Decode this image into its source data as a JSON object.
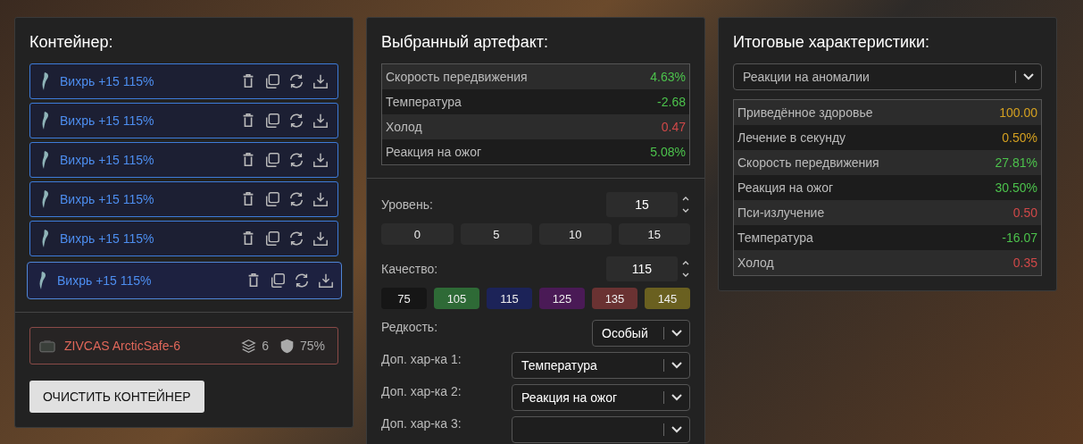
{
  "container": {
    "title": "Контейнер:",
    "artifacts": [
      {
        "name": "Вихрь +15 115%",
        "selected": false
      },
      {
        "name": "Вихрь +15 115%",
        "selected": false
      },
      {
        "name": "Вихрь +15 115%",
        "selected": false
      },
      {
        "name": "Вихрь +15 115%",
        "selected": false
      },
      {
        "name": "Вихрь +15 115%",
        "selected": false
      },
      {
        "name": "Вихрь +15 115%",
        "selected": true
      }
    ],
    "case": {
      "name": "ZIVCAS ArcticSafe-6",
      "slots": "6",
      "protection": "75%"
    },
    "clear_button": "ОЧИСТИТЬ КОНТЕЙНЕР"
  },
  "selected_artifact": {
    "title": "Выбранный артефакт:",
    "stats": [
      {
        "name": "Скорость передвижения",
        "value": "4.63%",
        "color": "#4cc24c"
      },
      {
        "name": "Температура",
        "value": "-2.68",
        "color": "#4cc24c"
      },
      {
        "name": "Холод",
        "value": "0.47",
        "color": "#d04848"
      },
      {
        "name": "Реакция на ожог",
        "value": "5.08%",
        "color": "#4cc24c"
      }
    ],
    "level": {
      "label": "Уровень:",
      "value": "15",
      "presets": [
        "0",
        "5",
        "10",
        "15"
      ]
    },
    "quality": {
      "label": "Качество:",
      "value": "115",
      "presets": [
        {
          "label": "75",
          "color": "#161616"
        },
        {
          "label": "105",
          "color": "#2e6a36"
        },
        {
          "label": "115",
          "color": "#1c2358"
        },
        {
          "label": "125",
          "color": "#4a1a56"
        },
        {
          "label": "135",
          "color": "#6a3232"
        },
        {
          "label": "145",
          "color": "#6a6020"
        }
      ]
    },
    "selects": [
      {
        "label": "Редкость:",
        "value": "Особый",
        "kind": "short"
      },
      {
        "label": "Доп. хар-ка 1:",
        "value": "Температура",
        "kind": "wide"
      },
      {
        "label": "Доп. хар-ка 2:",
        "value": "Реакция на ожог",
        "kind": "wide"
      },
      {
        "label": "Доп. хар-ка 3:",
        "kind": "wide"
      }
    ]
  },
  "totals": {
    "title": "Итоговые характеристики:",
    "filter": "Реакции на аномалии",
    "stats": [
      {
        "name": "Приведённое здоровье",
        "value": "100.00",
        "color": "#d4a020"
      },
      {
        "name": "Лечение в секунду",
        "value": "0.50%",
        "color": "#d4a020"
      },
      {
        "name": "Скорость передвижения",
        "value": "27.81%",
        "color": "#4cc24c"
      },
      {
        "name": "Реакция на ожог",
        "value": "30.50%",
        "color": "#4cc24c"
      },
      {
        "name": "Пси-излучение",
        "value": "0.50",
        "color": "#d04848"
      },
      {
        "name": "Температура",
        "value": "-16.07",
        "color": "#4cc24c"
      },
      {
        "name": "Холод",
        "value": "0.35",
        "color": "#d04848"
      }
    ]
  }
}
